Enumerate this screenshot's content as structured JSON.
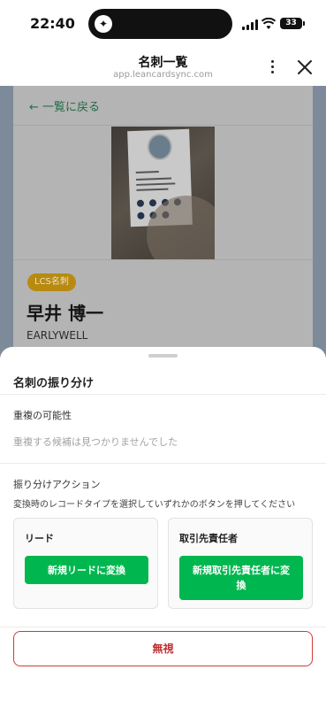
{
  "status_bar": {
    "time": "22:40",
    "battery": "33"
  },
  "nav": {
    "title": "名刺一覧",
    "url": "app.leancardsync.com"
  },
  "background_page": {
    "back_link": "← 一覧に戻る",
    "badge": "LCS名刺",
    "name": "早井 博一",
    "company": "EARLYWELL"
  },
  "sheet": {
    "title": "名刺の振り分け",
    "duplicate_section_label": "重複の可能性",
    "duplicate_result": "重複する候補は見つかりませんでした",
    "action_section_label": "振り分けアクション",
    "action_help": "変換時のレコードタイプを選択していずれかのボタンを押してください",
    "options": [
      {
        "label": "リード",
        "button": "新規リードに変換"
      },
      {
        "label": "取引先責任者",
        "button": "新規取引先責任者に変換"
      }
    ],
    "ignore_button": "無視"
  },
  "colors": {
    "accent_green": "#00b74f",
    "danger_red": "#c0302f",
    "badge_gold": "#b88a10"
  }
}
